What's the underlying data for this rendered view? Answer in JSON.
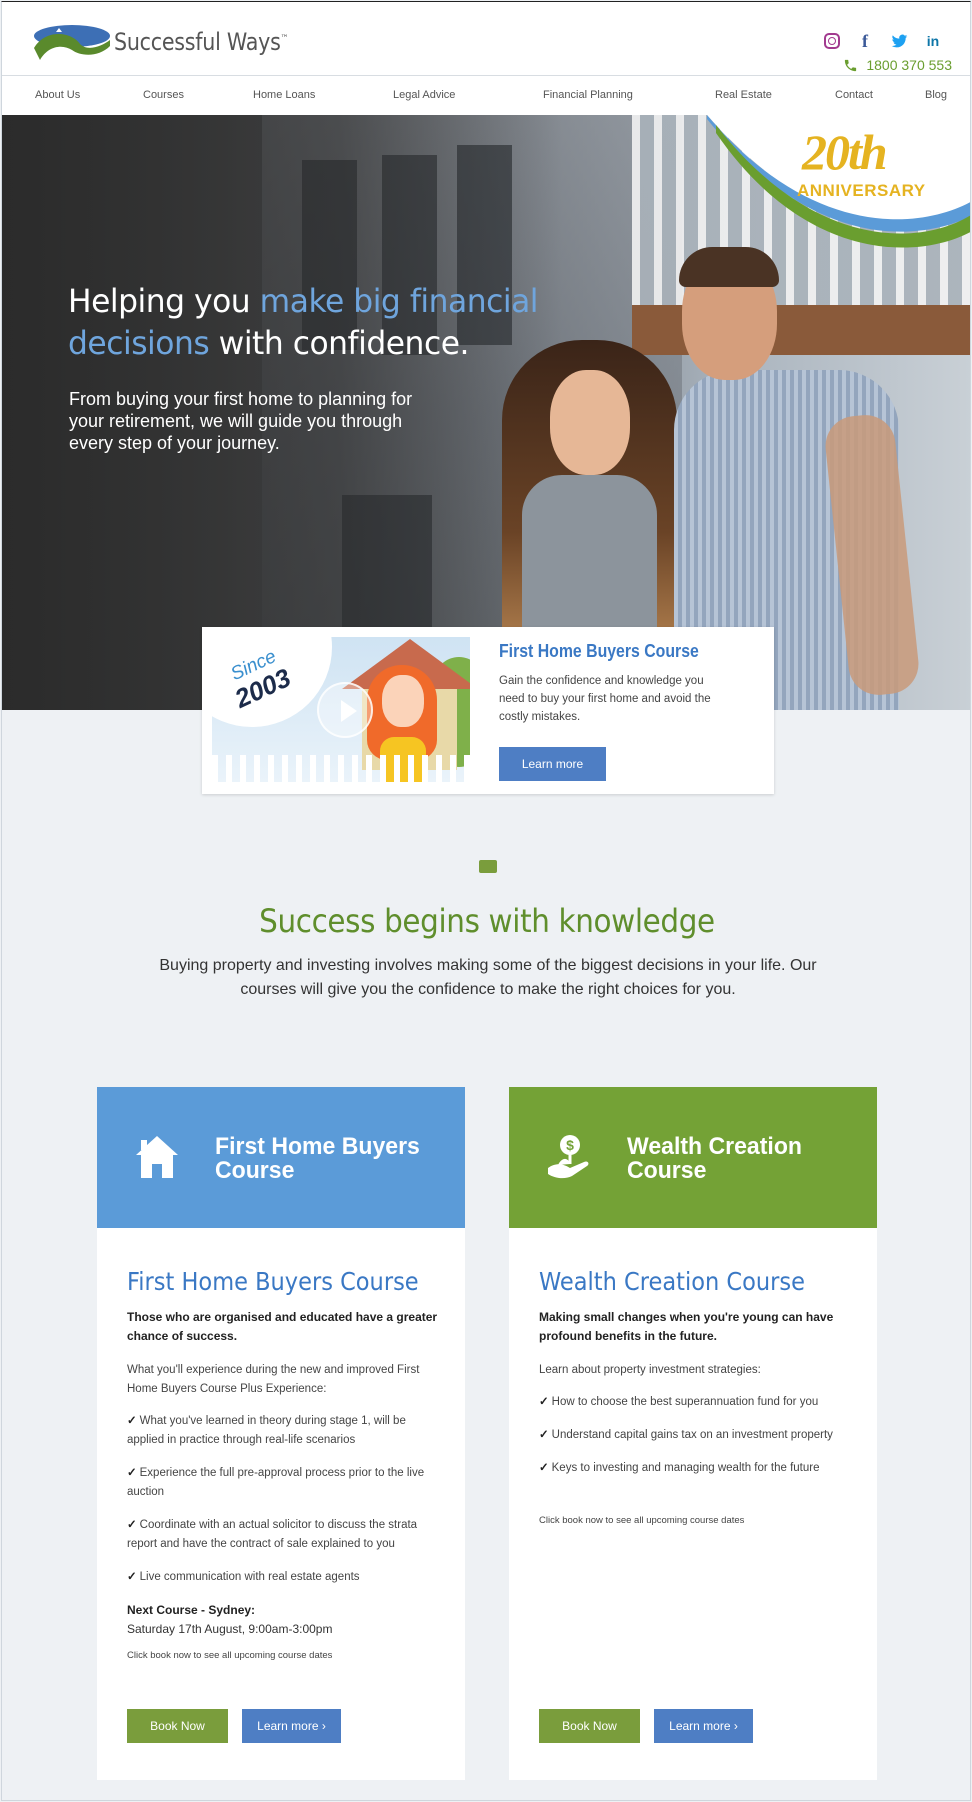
{
  "header": {
    "logo_text": "Successful Ways",
    "logo_tm": "™",
    "phone": "1800 370 553",
    "socials": [
      "instagram-icon",
      "facebook-icon",
      "twitter-icon",
      "linkedin-icon"
    ]
  },
  "nav": {
    "items": [
      "About Us",
      "Courses",
      "Home Loans",
      "Legal Advice",
      "Financial Planning",
      "Real Estate",
      "Contact",
      "Blog"
    ]
  },
  "hero": {
    "title_part1": "Helping you ",
    "title_highlight1": "make big financial decisions",
    "title_part2": " with confidence.",
    "subtitle": "From buying your first home to planning for your retirement, we will guide you through every step of your journey.",
    "anniversary_number": "20th",
    "anniversary_label": "ANNIVERSARY"
  },
  "promo": {
    "since_label": "Since",
    "since_year": "2003",
    "title": "First Home Buyers Course",
    "description": "Gain the confidence and knowledge you need to buy your first home and avoid the costly mistakes.",
    "button": "Learn more"
  },
  "section": {
    "title": "Success begins with knowledge",
    "text": "Buying property and investing involves making some of the biggest decisions in your life. Our courses will give you the confidence to make the right choices for you."
  },
  "cards": [
    {
      "head_title": "First Home Buyers Course",
      "head_color": "#5b9bd8",
      "title": "First Home Buyers Course",
      "lead": "Those who are organised and educated have a greater chance of success.",
      "intro": "What you'll experience during the new and improved First Home Buyers Course Plus Experience:",
      "checks": [
        "What you've learned in theory during stage 1, will be applied in practice through real-life scenarios",
        "Experience the full pre-approval process prior to the live auction",
        "Coordinate with an actual solicitor to discuss the strata report and have the contract of sale explained to you",
        "Live communication with real estate agents"
      ],
      "next_title": "Next Course - Sydney:",
      "next_date": "Saturday 17th August, 9:00am-3:00pm",
      "note": "Click book now to see all upcoming course dates",
      "book_button": "Book Now",
      "learn_button": "Learn more"
    },
    {
      "head_title": "Wealth Creation Course",
      "head_color": "#74a236",
      "title": "Wealth Creation Course",
      "lead": "Making small changes when you're young can have profound benefits in the future.",
      "intro": "Learn about property investment strategies:",
      "checks": [
        "How to choose the best superannuation fund for you",
        "Understand capital gains tax on an investment property",
        "Keys to investing and managing wealth for the future"
      ],
      "note": "Click book now to see all upcoming course dates",
      "book_button": "Book Now",
      "learn_button": "Learn more"
    }
  ],
  "colors": {
    "brand_green": "#6a9e2f",
    "brand_blue": "#3a78c4",
    "button_green": "#7a9d3c",
    "button_blue": "#4e7ec4",
    "anniversary_gold": "#e5b321"
  }
}
